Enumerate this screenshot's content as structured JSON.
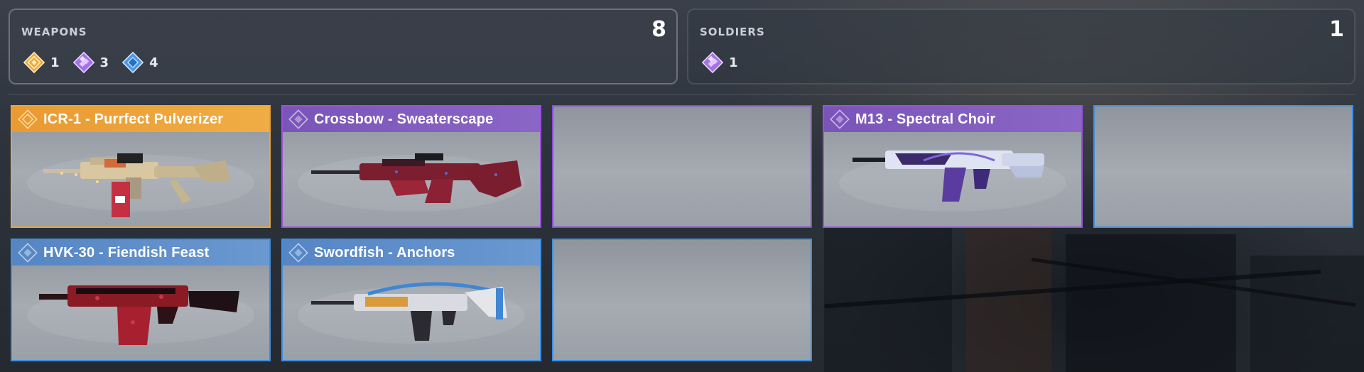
{
  "weapons_panel": {
    "title": "WEAPONS",
    "count": "8",
    "rarities": [
      {
        "icon": "legendary-rarity-icon",
        "color": "#f0a431",
        "count": "1"
      },
      {
        "icon": "epic-rarity-icon",
        "color": "#a66ee8",
        "count": "3"
      },
      {
        "icon": "rare-rarity-icon",
        "color": "#5aa0e8",
        "count": "4"
      }
    ]
  },
  "soldiers_panel": {
    "title": "SOLDIERS",
    "count": "1",
    "rarities": [
      {
        "icon": "epic-rarity-icon",
        "color": "#a66ee8",
        "count": "1"
      }
    ]
  },
  "items": [
    {
      "name": "ICR-1 - Purrfect Pulverizer",
      "rarity": "legendary",
      "color": "#f0a431"
    },
    {
      "name": "Crossbow - Sweaterscape",
      "rarity": "epic",
      "color": "#9c4fe0"
    },
    {
      "name": "",
      "rarity": "epic",
      "color": "#8a4ad6"
    },
    {
      "name": "M13 - Spectral Choir",
      "rarity": "epic",
      "color": "#9c4fe0"
    },
    {
      "name": "",
      "rarity": "rare",
      "color": "#3f8fe0"
    },
    {
      "name": "HVK-30 - Fiendish Feast",
      "rarity": "rare",
      "color": "#3f8fe0"
    },
    {
      "name": "Swordfish - Anchors",
      "rarity": "rare",
      "color": "#3f8fe0"
    },
    {
      "name": "",
      "rarity": "rare",
      "color": "#3f8fe0"
    }
  ]
}
